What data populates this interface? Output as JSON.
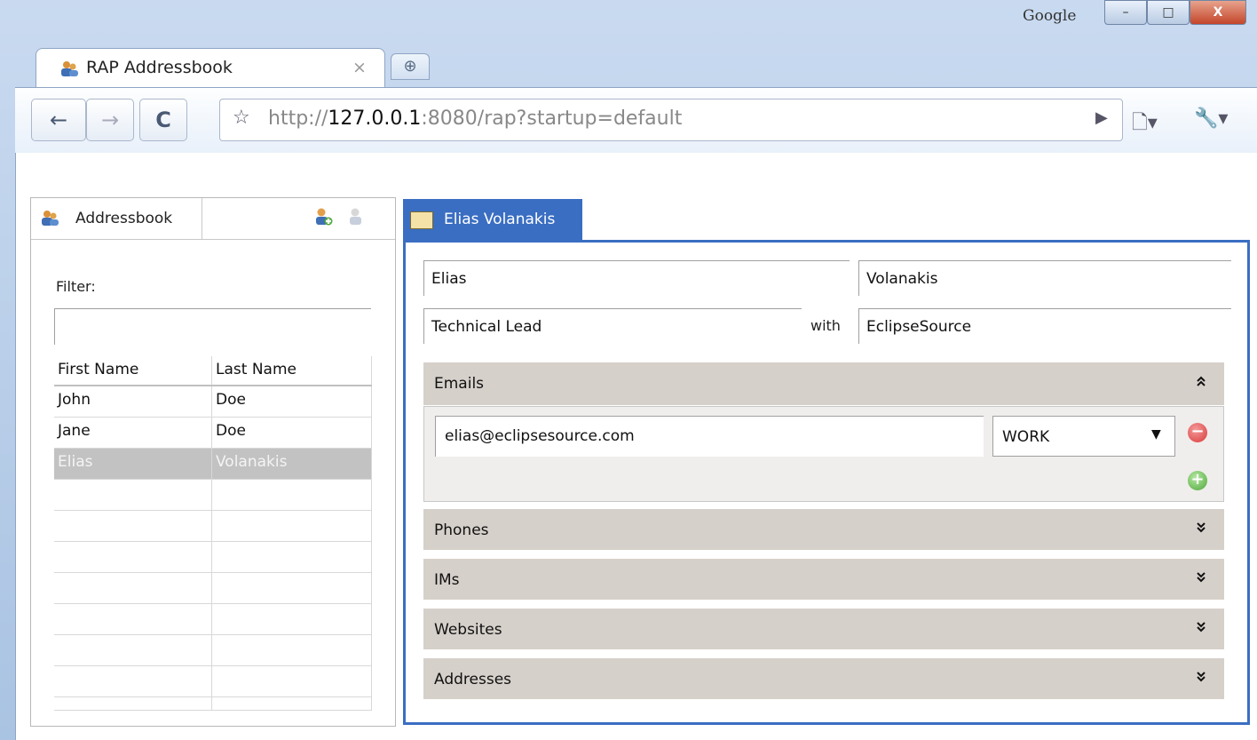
{
  "browser": {
    "brand_label": "Google",
    "window_buttons": {
      "minimize": "–",
      "maximize": "□",
      "close": "X"
    },
    "tab": {
      "title": "RAP Addressbook",
      "close": "×"
    },
    "new_tab": "⊕",
    "nav": {
      "back": "←",
      "forward": "→",
      "reload": "C"
    },
    "address": {
      "prefix": "http://",
      "host": "127.0.0.1",
      "suffix": ":8080/rap?startup=default",
      "star": "☆",
      "go": "▶"
    },
    "page_menu": "🗋▾",
    "tools_menu": "🔧▾"
  },
  "addressbook": {
    "tab_label": "Addressbook",
    "tools": {
      "add": "👤",
      "remove": "👤"
    },
    "filter_label": "Filter:",
    "filter_value": "",
    "columns": [
      "First Name",
      "Last Name"
    ],
    "rows": [
      {
        "first": "John",
        "last": "Doe",
        "selected": false
      },
      {
        "first": "Jane",
        "last": "Doe",
        "selected": false
      },
      {
        "first": "Elias",
        "last": "Volanakis",
        "selected": true
      }
    ],
    "empty_rows": 8
  },
  "editor": {
    "tab_label": "Elias Volanakis",
    "first_name": "Elias",
    "last_name": "Volanakis",
    "title": "Technical Lead",
    "with_label": "with",
    "company": "EclipseSource",
    "sections": {
      "emails": {
        "label": "Emails",
        "chevron": "«"
      },
      "phones": {
        "label": "Phones",
        "chevron": "»"
      },
      "ims": {
        "label": "IMs",
        "chevron": "»"
      },
      "websites": {
        "label": "Websites",
        "chevron": "»"
      },
      "addresses": {
        "label": "Addresses",
        "chevron": "»"
      }
    },
    "email": {
      "address": "elias@eclipsesource.com",
      "type": "WORK",
      "dropdown": "▼",
      "remove": "−",
      "add": "+"
    }
  },
  "colors": {
    "accent": "#3a6ec2",
    "section_bg": "#d6d0ca",
    "selection": "#c2c2c2"
  }
}
